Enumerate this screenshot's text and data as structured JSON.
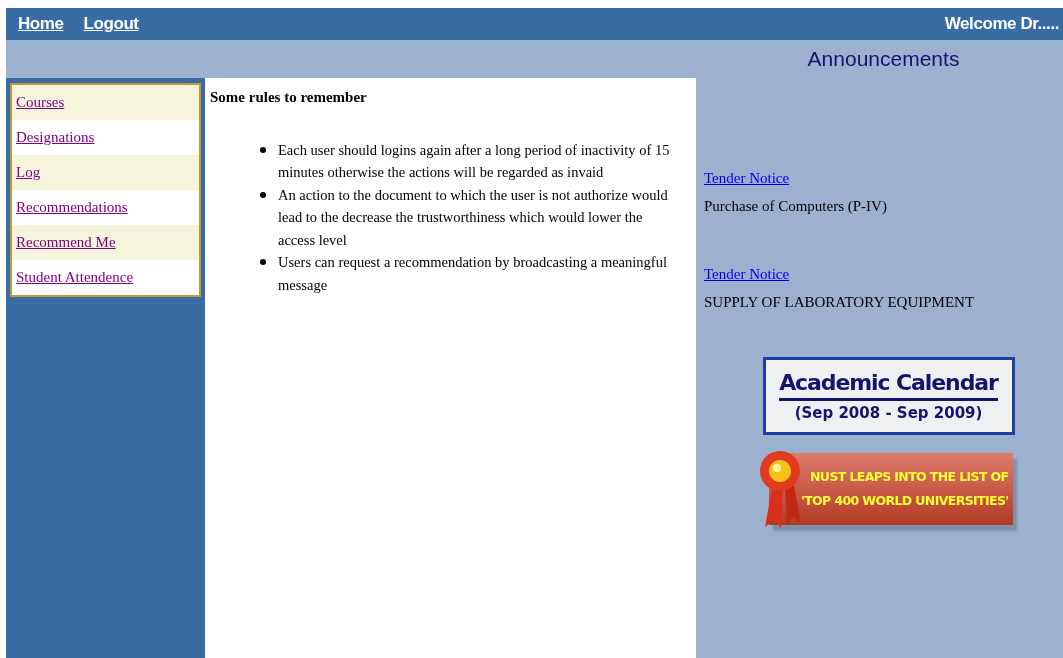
{
  "top_nav": {
    "links": [
      "Home",
      "Logout"
    ],
    "welcome": "Welcome Dr....."
  },
  "announcements": {
    "title": "Announcements",
    "items": [
      {
        "link": "Tender Notice",
        "text": "Purchase of Computers (P-IV)"
      },
      {
        "link": "Tender Notice",
        "text": "SUPPLY OF LABORATORY EQUIPMENT"
      }
    ],
    "banners": [
      {
        "kind": "calendar",
        "lines": [
          "Academic Calendar",
          "(Sep 2008 - Sep 2009)"
        ]
      },
      {
        "kind": "ranking",
        "lines": [
          "NUST LEAPS INTO THE LIST OF",
          "'TOP 400 WORLD UNIVERSITIES'"
        ]
      }
    ]
  },
  "sidebar": {
    "items": [
      "Courses",
      "Designations",
      "Log",
      "Recommendations",
      "Recommend Me",
      "Student Attendence"
    ]
  },
  "content": {
    "heading": "Some rules to remember",
    "rules": [
      "Each user should logins again after a long period of inactivity of 15 minutes otherwise the actions will be regarded as invaid",
      "An action to the document to which the user is not authorize would lead to the decrease the trustworthiness which would lower the access level",
      "Users can request a recommendation by broadcasting a meaningful message"
    ]
  }
}
